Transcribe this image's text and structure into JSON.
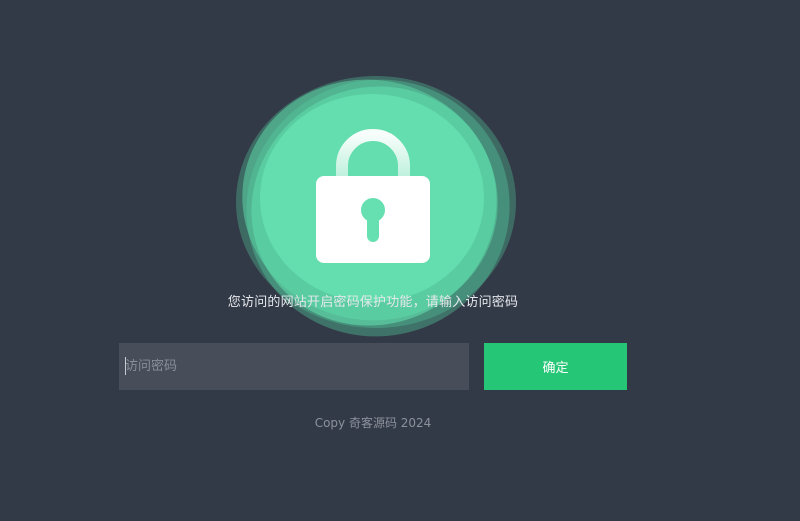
{
  "prompt": {
    "message": "您访问的网站开启密码保护功能，请输入访问密码"
  },
  "form": {
    "password_placeholder": "访问密码",
    "password_value": "",
    "confirm_label": "确定"
  },
  "footer": {
    "copyright": "Copy 奇客源码 2024"
  },
  "icons": {
    "lock": "lock-icon"
  },
  "colors": {
    "background": "#333a47",
    "accent": "#25c675",
    "blob": "#5fdcaa",
    "input_background": "#474d59"
  }
}
